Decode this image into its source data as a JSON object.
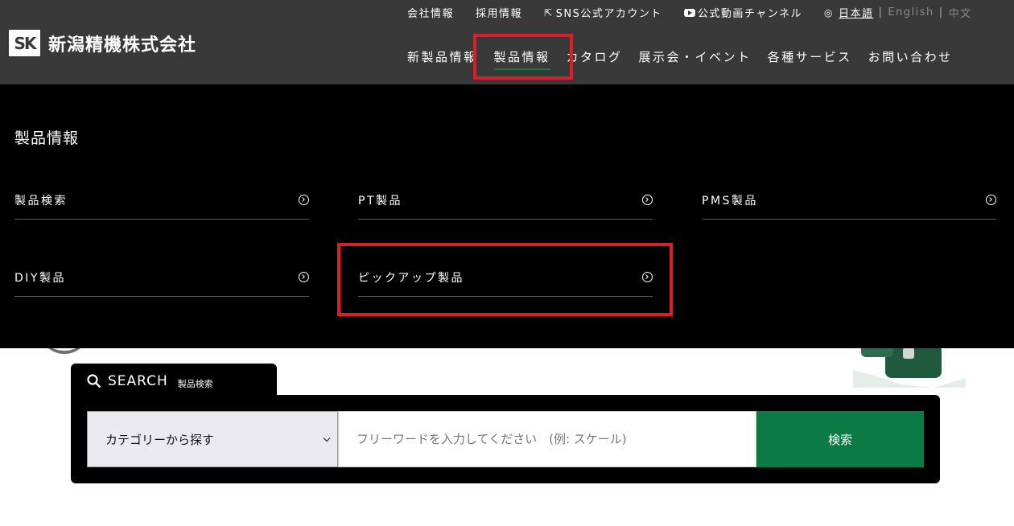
{
  "logo": {
    "mark": "SK",
    "company": "新潟精機株式会社"
  },
  "util_nav": [
    {
      "label": "会社情報"
    },
    {
      "label": "採用情報"
    },
    {
      "label": "SNS公式アカウント"
    },
    {
      "label": "公式動画チャンネル"
    }
  ],
  "lang": {
    "ja": "日本語",
    "en": "English",
    "zh": "中文"
  },
  "main_nav": [
    {
      "label": "新製品情報"
    },
    {
      "label": "製品情報"
    },
    {
      "label": "カタログ"
    },
    {
      "label": "展示会・イベント"
    },
    {
      "label": "各種サービス"
    },
    {
      "label": "お問い合わせ"
    }
  ],
  "mega_menu": {
    "title": "製品情報",
    "items": [
      {
        "label": "製品検索"
      },
      {
        "label": "PT製品"
      },
      {
        "label": "PMS製品"
      },
      {
        "label": "DIY製品"
      },
      {
        "label": "ピックアップ製品"
      }
    ]
  },
  "search": {
    "heading": "SEARCH",
    "subheading": "製品検索",
    "category_value": "カテゴリーから探す",
    "keyword_placeholder": "フリーワードを入力してください　(例: スケール)",
    "button_label": "検索"
  },
  "colors": {
    "header_bg": "#393939",
    "menu_bg": "#000000",
    "accent_green": "#0b7a45",
    "highlight_red": "#d9202a"
  }
}
